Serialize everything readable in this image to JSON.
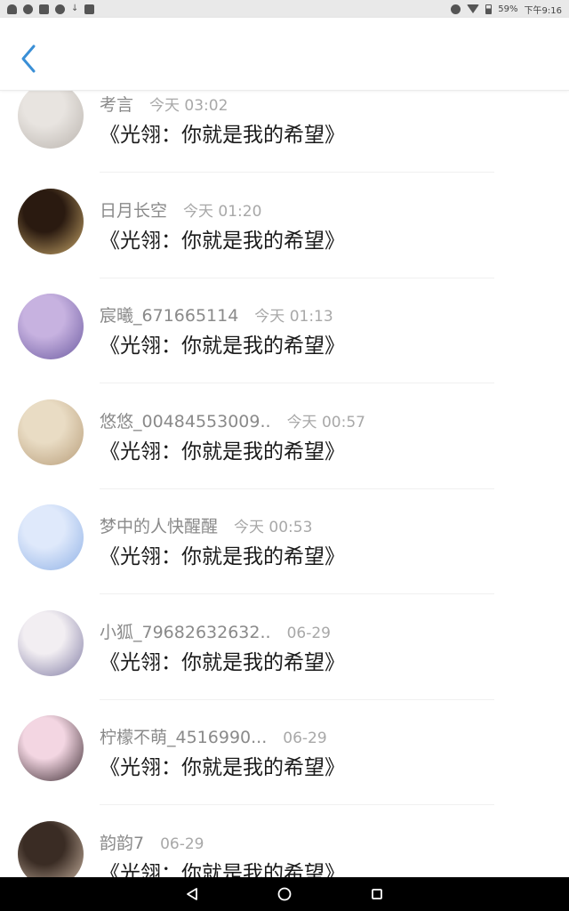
{
  "status_bar": {
    "battery": "59%",
    "time": "下午9:16"
  },
  "header": {
    "back_icon": "chevron-left-icon"
  },
  "comments": [
    {
      "username": "考言",
      "time": "今天 03:02",
      "content": "《光翎：你就是我的希望》",
      "avatar_colors": [
        "#e8e4e0",
        "#b9b3ad"
      ]
    },
    {
      "username": "日月长空",
      "time": "今天 01:20",
      "content": "《光翎：你就是我的希望》",
      "avatar_colors": [
        "#2a1a10",
        "#c9a86a"
      ]
    },
    {
      "username": "宸曦_671665114",
      "time": "今天 01:13",
      "content": "《光翎：你就是我的希望》",
      "avatar_colors": [
        "#c7b2e0",
        "#6b5aa0"
      ]
    },
    {
      "username": "悠悠_00484553009..",
      "time": "今天 00:57",
      "content": "《光翎：你就是我的希望》",
      "avatar_colors": [
        "#e9dcc4",
        "#b79c78"
      ]
    },
    {
      "username": "梦中的人快醒醒",
      "time": "今天 00:53",
      "content": "《光翎：你就是我的希望》",
      "avatar_colors": [
        "#dfe9fb",
        "#8fb1e6"
      ]
    },
    {
      "username": "小狐_79682632632..",
      "time": "06-29",
      "content": "《光翎：你就是我的希望》",
      "avatar_colors": [
        "#f2eef2",
        "#7f7aa3"
      ]
    },
    {
      "username": "柠檬不萌_4516990...",
      "time": "06-29",
      "content": "《光翎：你就是我的希望》",
      "avatar_colors": [
        "#f3d6e2",
        "#3a2a30"
      ]
    },
    {
      "username": "韵韵7",
      "time": "06-29",
      "content": "《光翎：你就是我的希望》",
      "avatar_colors": [
        "#3a2c24",
        "#cfb9a6"
      ]
    }
  ],
  "nav_bar": {
    "icons": [
      "back-triangle-icon",
      "home-circle-icon",
      "recents-square-icon"
    ]
  }
}
